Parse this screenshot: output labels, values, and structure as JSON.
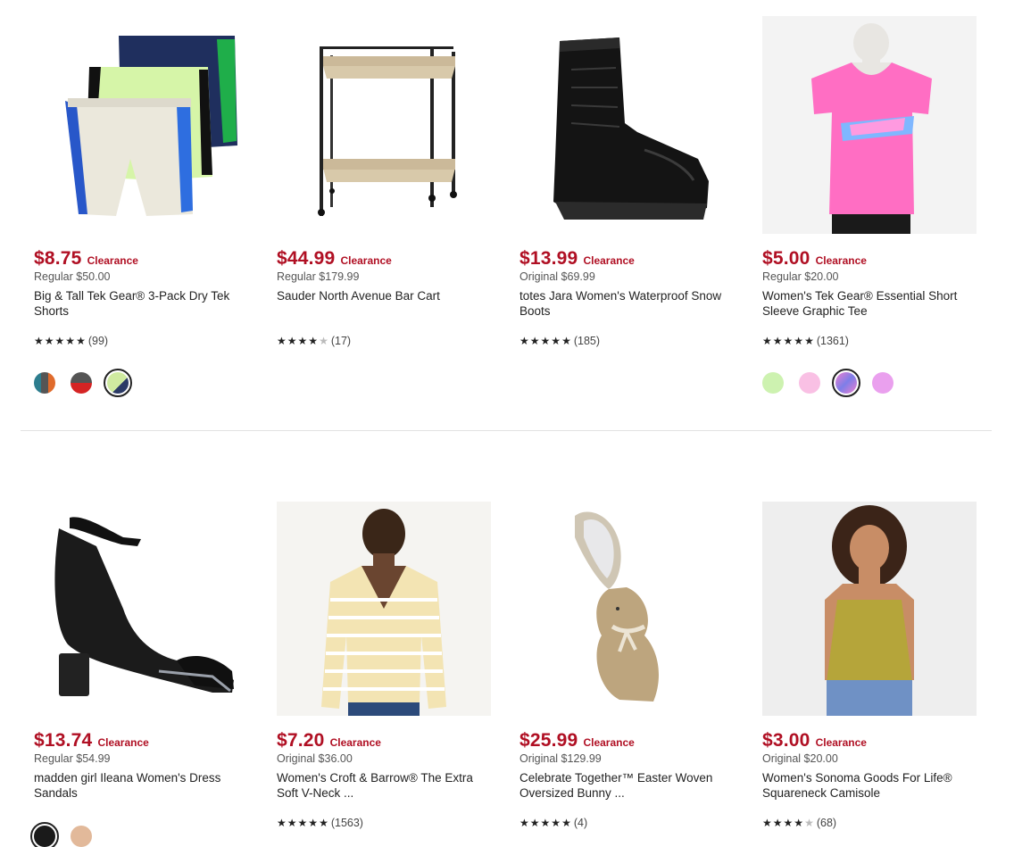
{
  "products": [
    {
      "price": "$8.75",
      "badge": "Clearance",
      "regular": "Regular $50.00",
      "title": "Big & Tall Tek Gear® 3-Pack Dry Tek Shorts",
      "rating": 4.5,
      "count": "(99)",
      "swatches": [
        {
          "color": "#2d7d8e",
          "selected": false
        },
        {
          "color": "#4b4b4b",
          "selected": false
        },
        {
          "color": "#cfeaa0",
          "selected": true
        }
      ]
    },
    {
      "price": "$44.99",
      "badge": "Clearance",
      "regular": "Regular $179.99",
      "title": "Sauder North Avenue Bar Cart",
      "rating": 4,
      "count": "(17)",
      "swatches": []
    },
    {
      "price": "$13.99",
      "badge": "Clearance",
      "regular": "Original $69.99",
      "title": "totes Jara Women's Waterproof Snow Boots",
      "rating": 4.5,
      "count": "(185)",
      "swatches": []
    },
    {
      "price": "$5.00",
      "badge": "Clearance",
      "regular": "Regular $20.00",
      "title": "Women's Tek Gear® Essential Short Sleeve Graphic Tee",
      "rating": 4.5,
      "count": "(1361)",
      "swatches": [
        {
          "color": "#cdf2b0",
          "selected": false
        },
        {
          "color": "#f9c0e4",
          "selected": false
        },
        {
          "color": "#c98ee0",
          "selected": true
        },
        {
          "color": "#eaa0ee",
          "selected": false
        }
      ]
    },
    {
      "price": "$13.74",
      "badge": "Clearance",
      "regular": "Regular $54.99",
      "title": "madden girl Ileana Women's Dress Sandals",
      "rating": 0,
      "count": "",
      "swatches": [
        {
          "color": "#1a1a1a",
          "selected": true
        },
        {
          "color": "#e2b99a",
          "selected": false
        }
      ]
    },
    {
      "price": "$7.20",
      "badge": "Clearance",
      "regular": "Original $36.00",
      "title": "Women's Croft & Barrow® The Extra Soft V-Neck ...",
      "rating": 4.5,
      "count": "(1563)",
      "swatches": []
    },
    {
      "price": "$25.99",
      "badge": "Clearance",
      "regular": "Original $129.99",
      "title": "Celebrate Together™ Easter Woven Oversized Bunny ...",
      "rating": 5,
      "count": "(4)",
      "swatches": []
    },
    {
      "price": "$3.00",
      "badge": "Clearance",
      "regular": "Original $20.00",
      "title": "Women's Sonoma Goods For Life® Squareneck Camisole",
      "rating": 4,
      "count": "(68)",
      "swatches": []
    }
  ],
  "icons": [
    "shorts-image",
    "bar-cart-image",
    "snow-boot-image",
    "graphic-tee-image",
    "sandal-image",
    "sweater-image",
    "bunny-image",
    "camisole-image",
    "star-icon"
  ]
}
